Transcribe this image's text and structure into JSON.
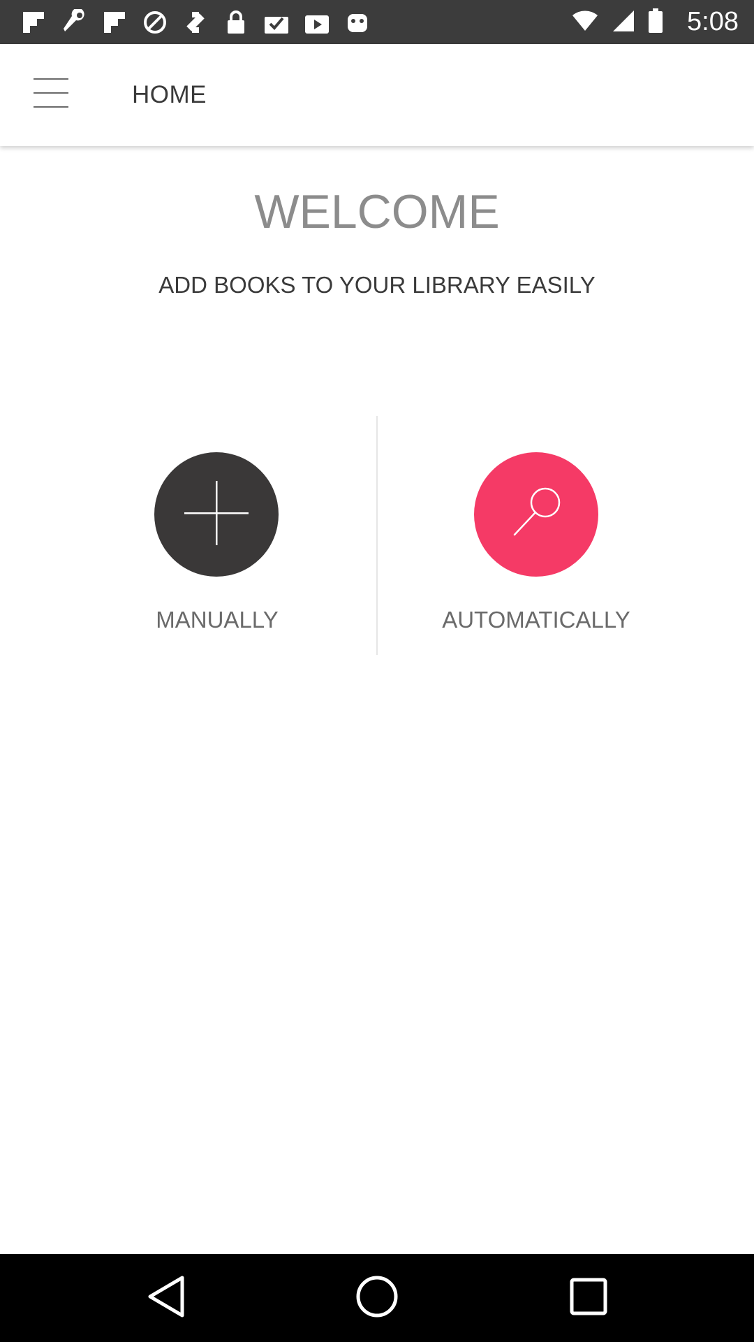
{
  "status_bar": {
    "time": "5:08",
    "icons": [
      "flipboard-icon",
      "wrench-icon",
      "flipboard-icon",
      "block-icon",
      "fake-gps-icon",
      "lock-icon",
      "clipboard-check-icon",
      "play-store-icon",
      "android-icon"
    ]
  },
  "toolbar": {
    "title": "HOME",
    "menu_icon": "hamburger-menu-icon"
  },
  "content": {
    "welcome": "WELCOME",
    "subtitle": "ADD BOOKS TO YOUR LIBRARY EASILY"
  },
  "options": [
    {
      "label": "MANUALLY",
      "icon": "plus-icon",
      "color": "#3a3838"
    },
    {
      "label": "AUTOMATICALLY",
      "icon": "magnifier-icon",
      "color": "#f53a66"
    }
  ],
  "nav_bar": {
    "buttons": [
      "back-icon",
      "home-icon",
      "recent-apps-icon"
    ]
  }
}
